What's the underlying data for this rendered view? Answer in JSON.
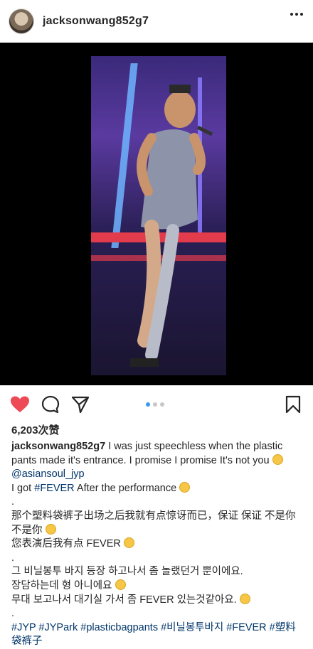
{
  "post": {
    "username": "jacksonwang852g7",
    "likes": "6,203次赞"
  },
  "caption": {
    "username": "jacksonwang852g7",
    "line1": " I was just speechless when the plastic pants made it's entrance. I promise I promise It's not you",
    "mention": "@asiansoul_jyp",
    "line2": "I got ",
    "tag_fever": "#FEVER",
    "line2_end": " After the performance",
    "dot": ".",
    "zh1": "那个塑料袋裤子出场之后我就有点惊讶而已，保证 保证 不是你 不是你",
    "zh2": "您表演后我有点 FEVER",
    "ko1": "그 비닐봉투 바지 등장 하고나서 좀 놀랬던거 뿐이에요.",
    "ko2": "장담하는데 형 아니에요",
    "ko3": "무대 보고나서 대기실 가서 좀 FEVER 있는것같아요.",
    "hashtags": "#JYP #JYPark #plasticbagpants #비닐봉투바지 #FEVER #塑料袋裤子"
  },
  "icons": {
    "like": "heart-filled-icon",
    "comment": "comment-icon",
    "share": "send-icon",
    "save": "bookmark-icon",
    "more": "more-dots-icon"
  },
  "colors": {
    "like": "#ed4956",
    "carousel_active": "#3897f0",
    "hashtag": "#003569"
  }
}
